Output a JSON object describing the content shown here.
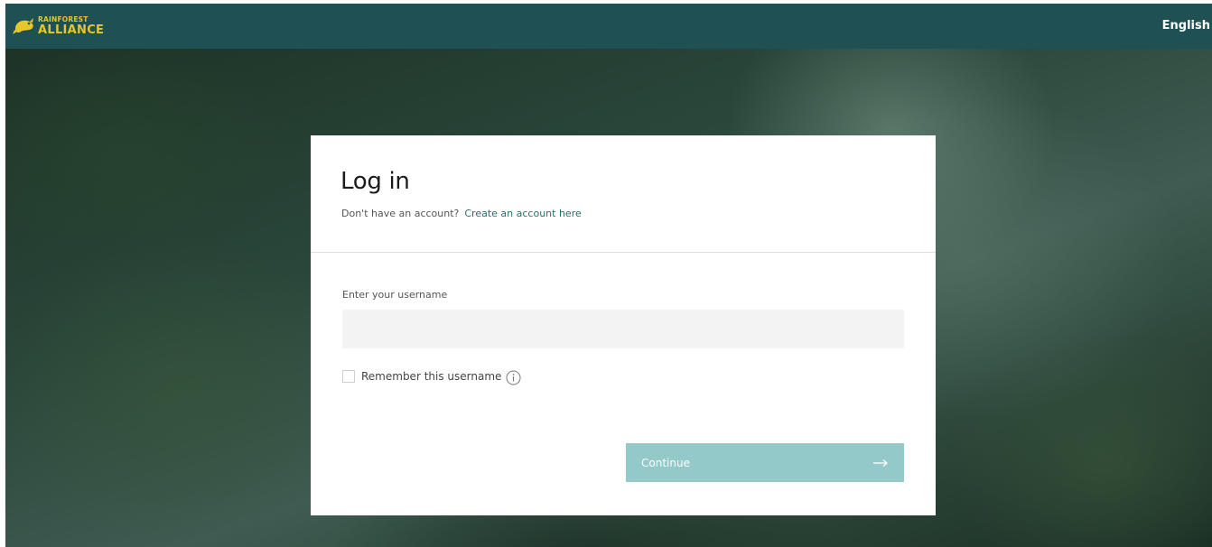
{
  "header": {
    "logo_line1": "RAINFOREST",
    "logo_line2": "ALLIANCE",
    "logo_icon": "frog-icon",
    "language": "English",
    "bar_color": "#1f5054",
    "logo_color": "#e6c72b"
  },
  "login": {
    "title": "Log in",
    "no_account_text": "Don't have an account?",
    "create_account_link": "Create an account here",
    "username_label": "Enter your username",
    "username_value": "",
    "remember_label": "Remember this username",
    "remember_checked": false,
    "info_icon": "info-icon",
    "continue_label": "Continue",
    "continue_icon": "arrow-right-icon",
    "button_color": "#94c9c9"
  }
}
